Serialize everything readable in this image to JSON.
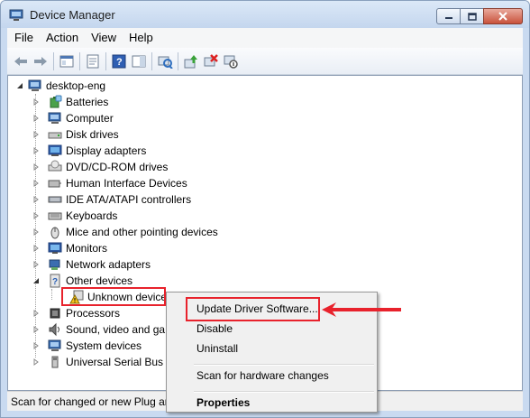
{
  "window": {
    "title": "Device Manager"
  },
  "menu": [
    "File",
    "Action",
    "View",
    "Help"
  ],
  "toolbar": [
    "back-icon",
    "forward-icon",
    "show-hide-console-tree-icon",
    "properties-pane-icon",
    "help-icon",
    "action-pane-icon",
    "scan-hardware-changes-icon",
    "update-driver-icon",
    "uninstall-icon",
    "disable-icon"
  ],
  "tree": {
    "root": "desktop-eng",
    "categories": [
      {
        "label": "Batteries",
        "icon": "battery-icon"
      },
      {
        "label": "Computer",
        "icon": "computer-icon"
      },
      {
        "label": "Disk drives",
        "icon": "disk-drive-icon"
      },
      {
        "label": "Display adapters",
        "icon": "display-adapter-icon"
      },
      {
        "label": "DVD/CD-ROM drives",
        "icon": "dvd-drive-icon"
      },
      {
        "label": "Human Interface Devices",
        "icon": "hid-icon"
      },
      {
        "label": "IDE ATA/ATAPI controllers",
        "icon": "ide-controller-icon"
      },
      {
        "label": "Keyboards",
        "icon": "keyboard-icon"
      },
      {
        "label": "Mice and other pointing devices",
        "icon": "mouse-icon"
      },
      {
        "label": "Monitors",
        "icon": "monitor-icon"
      },
      {
        "label": "Network adapters",
        "icon": "network-adapter-icon"
      },
      {
        "label": "Other devices",
        "icon": "other-devices-icon",
        "expanded": true
      },
      {
        "label": "Unknown device",
        "icon": "unknown-device-warning-icon",
        "child": true
      },
      {
        "label": "Processors",
        "icon": "processor-icon"
      },
      {
        "label": "Sound, video and ga",
        "icon": "sound-icon"
      },
      {
        "label": "System devices",
        "icon": "system-devices-icon"
      },
      {
        "label": "Universal Serial Bus c",
        "icon": "usb-icon"
      }
    ]
  },
  "context_menu": {
    "items": [
      "Update Driver Software...",
      "Disable",
      "Uninstall",
      "Scan for hardware changes",
      "Properties"
    ]
  },
  "status": {
    "text": "Scan for changed or new Plug ar"
  },
  "colors": {
    "highlight": "#e8222c",
    "titlebar": "#c4d6ee"
  }
}
